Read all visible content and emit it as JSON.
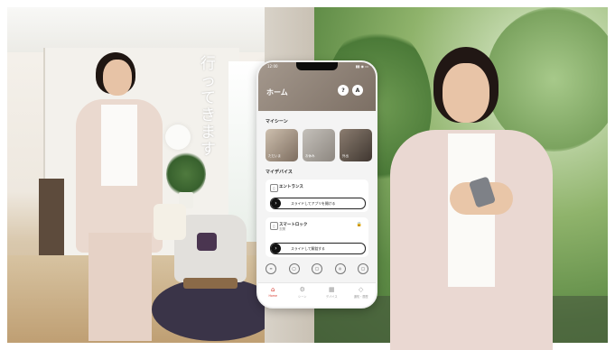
{
  "overlay": {
    "vertical_text": "行ってきます"
  },
  "phone": {
    "status": {
      "time": "12:00",
      "icons": "▮▮ ◉ ▭"
    },
    "header": {
      "title": "ホーム",
      "help_label": "?",
      "account_label": "A"
    },
    "scenes": {
      "section_title": "マイシーン",
      "items": [
        {
          "label": "ただいま"
        },
        {
          "label": "お休み"
        },
        {
          "label": "外出"
        }
      ]
    },
    "devices": {
      "section_title": "マイデバイス",
      "items": [
        {
          "name": "エントランス",
          "sub": "",
          "status": "",
          "slide_label": "スライドしてアプリを開ける"
        },
        {
          "name": "スマートロック",
          "sub": "玄関",
          "status": "🔒",
          "slide_label": "スライドして解錠する"
        }
      ]
    },
    "utilities": [
      "≡",
      "◯",
      "◯",
      "◎",
      "◯"
    ],
    "tabs": [
      {
        "label": "Home",
        "icon": "⌂"
      },
      {
        "label": "シーン",
        "icon": "⚙"
      },
      {
        "label": "デバイス",
        "icon": "▦"
      },
      {
        "label": "通知・履歴",
        "icon": "◇"
      }
    ]
  }
}
